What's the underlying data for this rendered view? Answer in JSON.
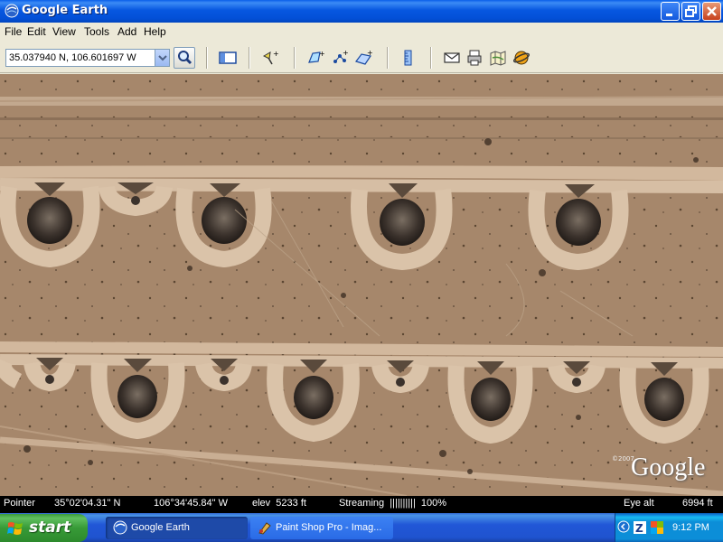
{
  "window": {
    "title": "Google Earth"
  },
  "menu": [
    "File",
    "Edit",
    "View",
    "Tools",
    "Add",
    "Help"
  ],
  "toolbar": {
    "search_value": "35.037940 N, 106.601697 W"
  },
  "map": {
    "copyright": "©2007",
    "logo": "Google"
  },
  "status": {
    "pointer_label": "Pointer",
    "lat": "35°02'04.31\" N",
    "lon": "106°34'45.84\" W",
    "elev": "elev  5233 ft",
    "streaming": "Streaming  ||||||||||  100%",
    "eye_label": "Eye alt",
    "eye_value": "6994 ft"
  },
  "taskbar": {
    "start_label": "start",
    "tasks": [
      "Google Earth",
      "Paint Shop Pro - Imag..."
    ],
    "clock": "9:12 PM"
  },
  "colors": {
    "title_bar": "#0a5ee9",
    "taskbar": "#2157d7",
    "start": "#3c9a3c",
    "terrain": "#a2846a"
  }
}
